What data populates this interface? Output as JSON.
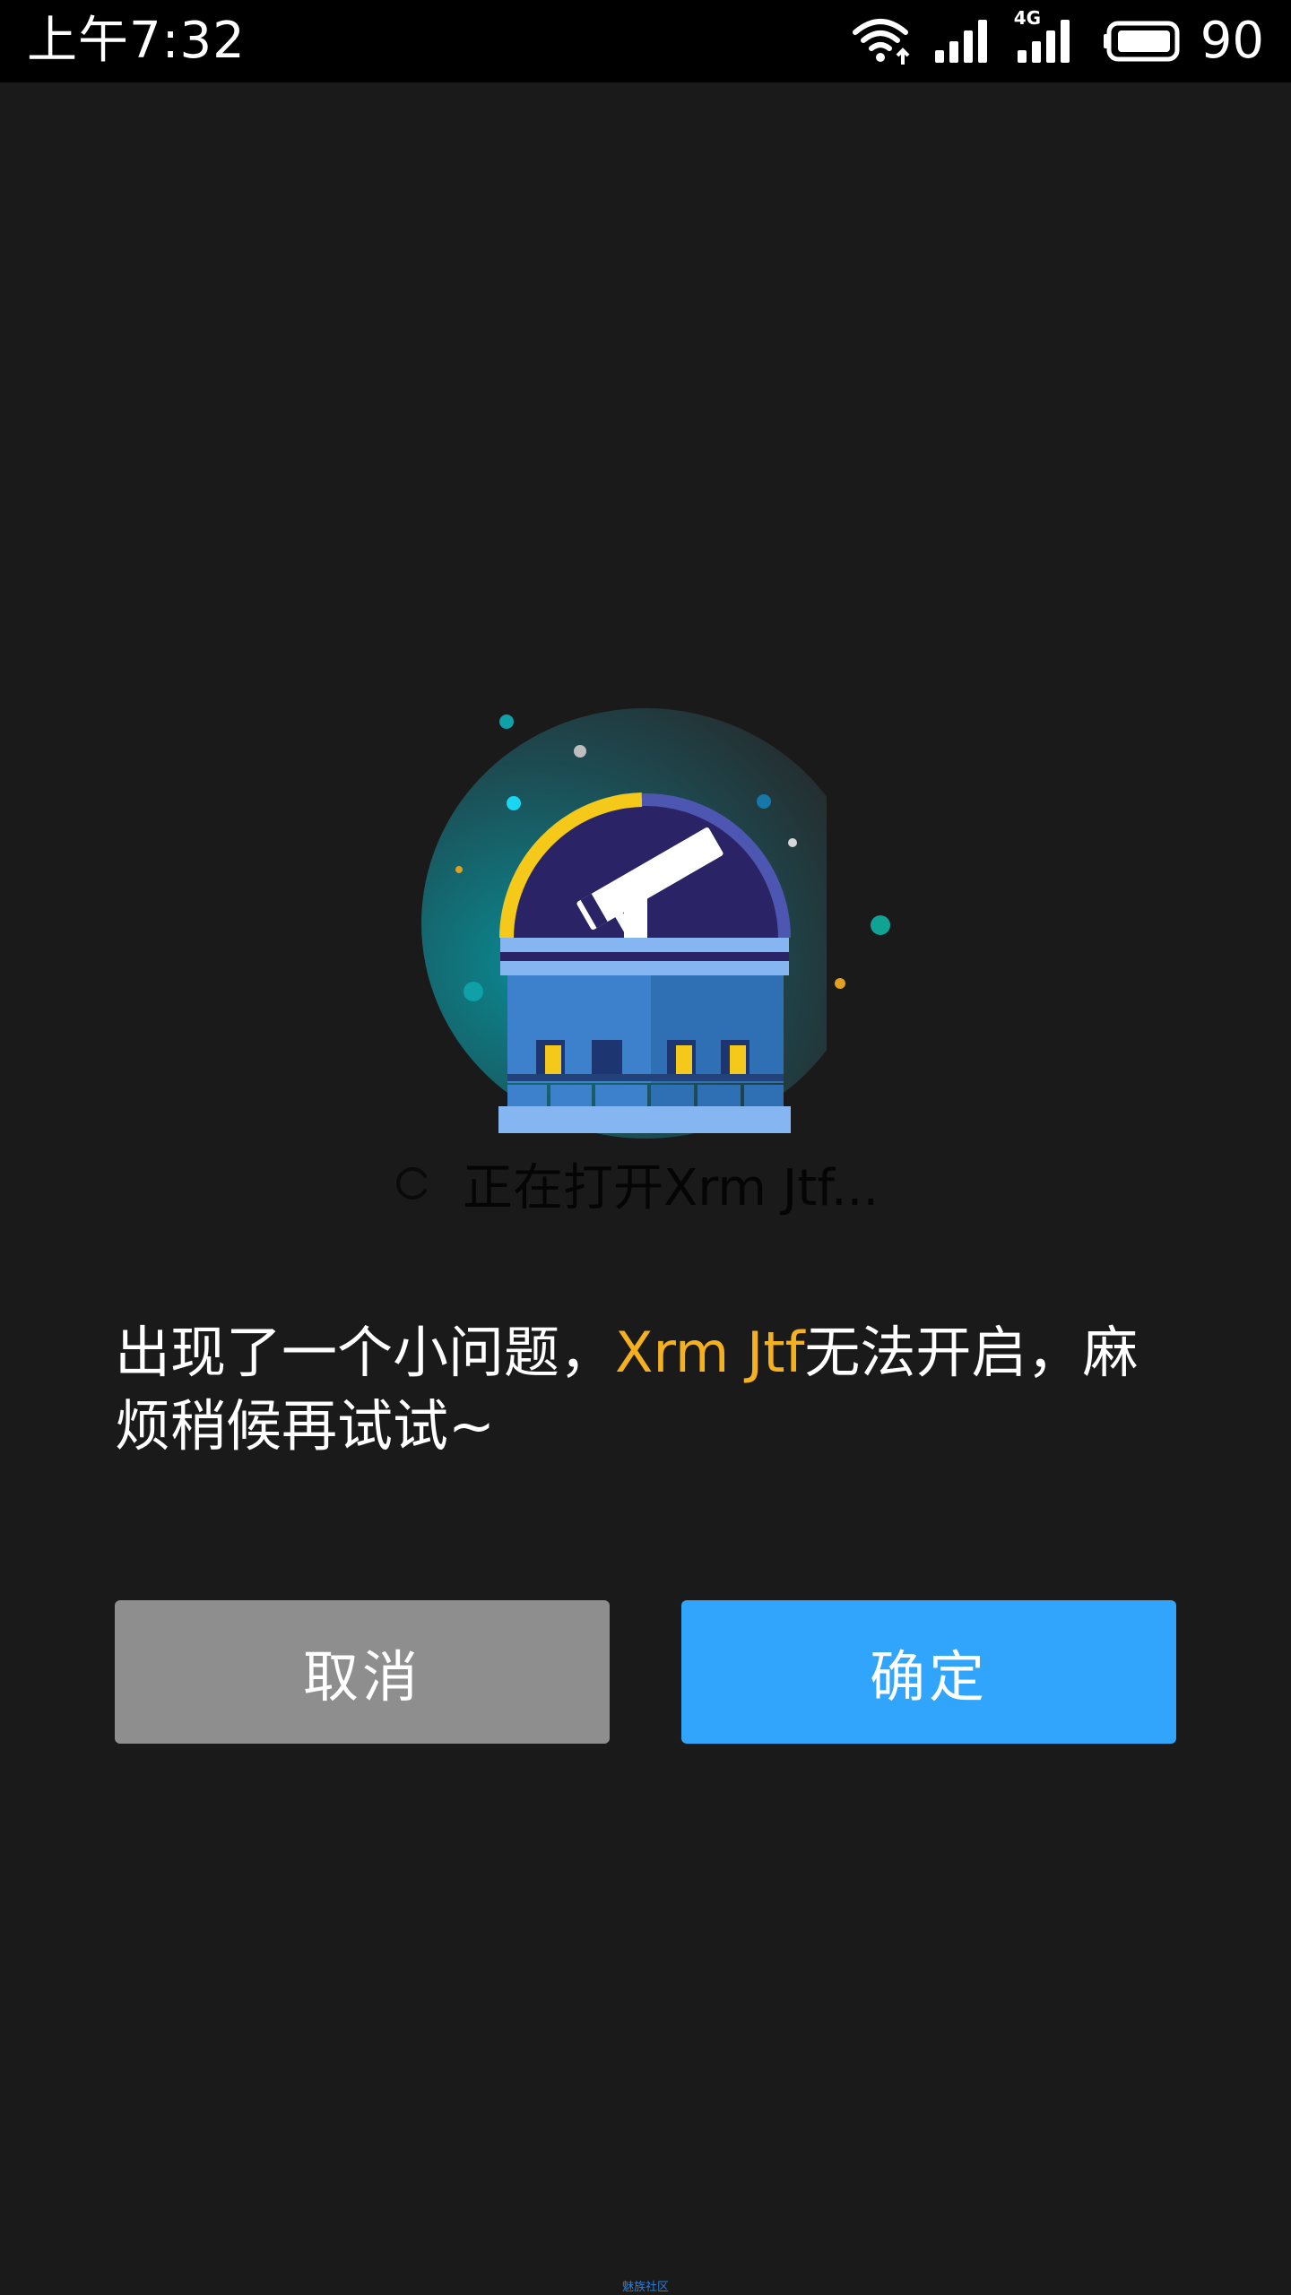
{
  "status_bar": {
    "time": "上午7:32",
    "network_type": "4G",
    "battery_level": "90",
    "icons": [
      "wifi-icon",
      "cellular-signal-icon",
      "4g-signal-icon",
      "battery-icon"
    ]
  },
  "loading": {
    "text": "正在打开Xrm Jtf..."
  },
  "message": {
    "prefix": "出现了一个小问题，",
    "app_name": "Xrm Jtf",
    "suffix": "无法开启，麻烦稍候再试试~"
  },
  "buttons": {
    "cancel_label": "取消",
    "confirm_label": "确定"
  },
  "watermark": {
    "text": "魅族社区"
  },
  "colors": {
    "background": "#1a1a1a",
    "status_bar": "#000000",
    "accent": "#f5b020",
    "cancel_button": "#8e8e8e",
    "confirm_button": "#31a4fb"
  }
}
